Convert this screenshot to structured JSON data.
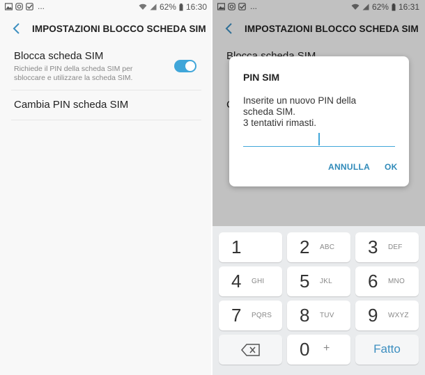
{
  "left": {
    "status": {
      "notif_icons": [
        "image-icon",
        "instagram-icon",
        "check-icon"
      ],
      "dots": "...",
      "battery": "62%",
      "time": "16:30"
    },
    "title": "IMPOSTAZIONI BLOCCO SCHEDA SIM",
    "lock_sim": {
      "label": "Blocca scheda SIM",
      "description": "Richiede il PIN della scheda SIM per sbloccare e utilizzare la scheda SIM.",
      "enabled": true
    },
    "change_pin": {
      "label": "Cambia PIN scheda SIM"
    }
  },
  "right": {
    "status": {
      "notif_icons": [
        "image-icon",
        "instagram-icon",
        "check-icon"
      ],
      "dots": "...",
      "battery": "62%",
      "time": "16:31"
    },
    "title": "IMPOSTAZIONI BLOCCO SCHEDA SIM",
    "bg_row1": "Blocca scheda SIM",
    "bg_row2": "C",
    "dialog": {
      "title": "PIN SIM",
      "message_line1": "Inserite un nuovo PIN della",
      "message_line2": "scheda SIM.",
      "message_line3": "3 tentativi rimasti.",
      "input_value": "",
      "cancel_label": "ANNULLA",
      "ok_label": "OK"
    },
    "keypad": {
      "keys": [
        {
          "num": "1",
          "letters": ""
        },
        {
          "num": "2",
          "letters": "ABC"
        },
        {
          "num": "3",
          "letters": "DEF"
        },
        {
          "num": "4",
          "letters": "GHI"
        },
        {
          "num": "5",
          "letters": "JKL"
        },
        {
          "num": "6",
          "letters": "MNO"
        },
        {
          "num": "7",
          "letters": "PQRS"
        },
        {
          "num": "8",
          "letters": "TUV"
        },
        {
          "num": "9",
          "letters": "WXYZ"
        }
      ],
      "zero": "0",
      "plus": "+",
      "done_label": "Fatto"
    }
  },
  "colors": {
    "accent": "#40a6d9",
    "button_text": "#2f8ab9",
    "background": "#f8f8f8",
    "keypad_bg": "#e9ebed"
  }
}
